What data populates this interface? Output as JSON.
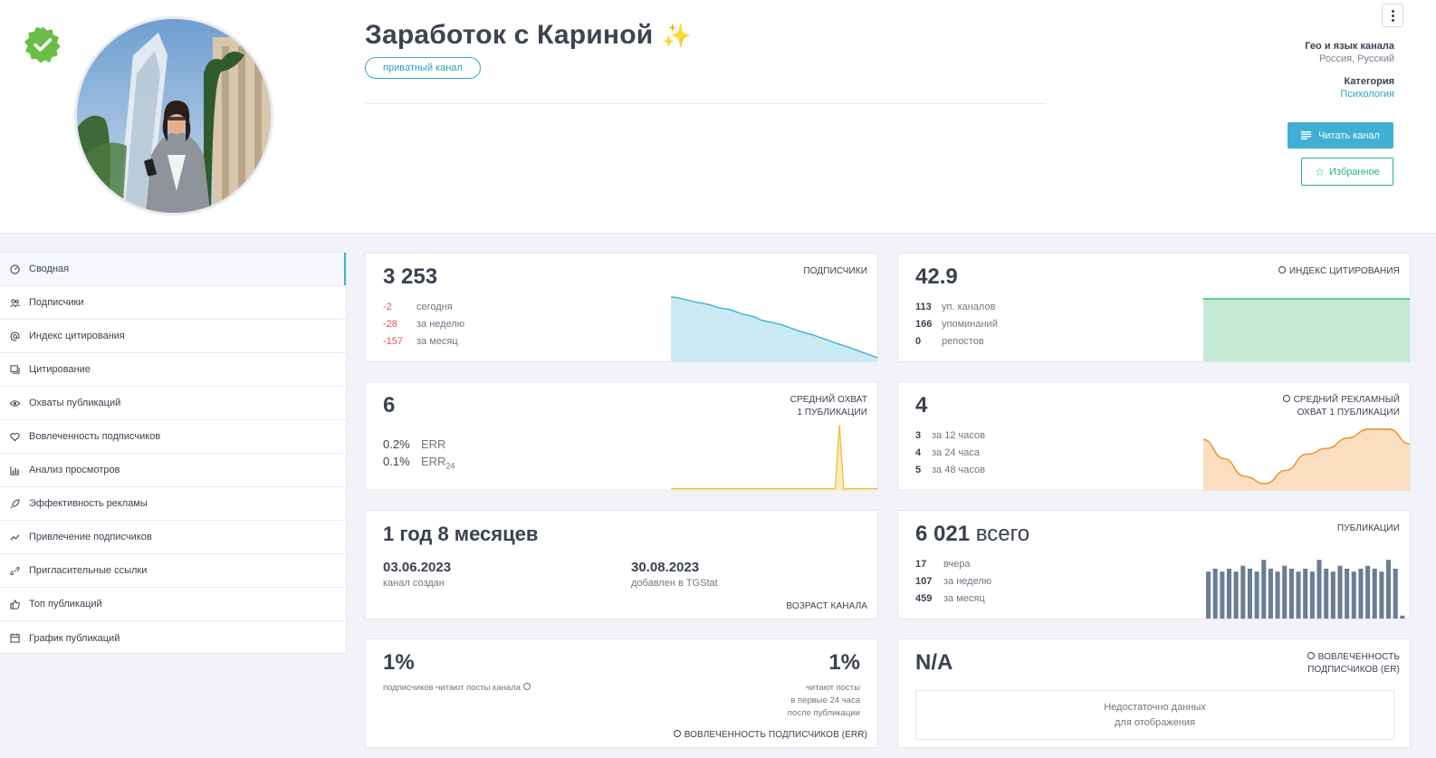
{
  "header": {
    "title": "Заработок с Кариной",
    "title_emoji": "✨",
    "badge": "приватный канал",
    "geo_label": "Гео и язык канала",
    "geo_value": "Россия, Русский",
    "category_label": "Категория",
    "category_value": "Психология",
    "read_button": "Читать канал",
    "favorite_button": "Избранное"
  },
  "sidebar": {
    "items": [
      {
        "label": "Сводная",
        "icon": "dashboard-icon"
      },
      {
        "label": "Подписчики",
        "icon": "users-icon"
      },
      {
        "label": "Индекс цитирования",
        "icon": "at-icon"
      },
      {
        "label": "Цитирование",
        "icon": "quote-icon"
      },
      {
        "label": "Охваты публикаций",
        "icon": "eye-icon"
      },
      {
        "label": "Вовлеченность подписчиков",
        "icon": "heart-icon"
      },
      {
        "label": "Анализ просмотров",
        "icon": "bar-chart-icon"
      },
      {
        "label": "Эффективность рекламы",
        "icon": "rocket-icon"
      },
      {
        "label": "Привлечение подписчиков",
        "icon": "trend-icon"
      },
      {
        "label": "Пригласительные ссылки",
        "icon": "link-icon"
      },
      {
        "label": "Топ публикаций",
        "icon": "thumbs-up-icon"
      },
      {
        "label": "График публикаций",
        "icon": "calendar-icon"
      }
    ]
  },
  "subscribers": {
    "value": "3 253",
    "caption": "ПОДПИСЧИКИ",
    "rows": [
      {
        "n": "-2",
        "t": "сегодня"
      },
      {
        "n": "-28",
        "t": "за неделю"
      },
      {
        "n": "-157",
        "t": "за месяц"
      }
    ],
    "color": "#3fb0d4"
  },
  "citation": {
    "value": "42.9",
    "caption": "ИНДЕКС ЦИТИРОВАНИЯ",
    "rows": [
      {
        "n": "113",
        "t": "уп. каналов"
      },
      {
        "n": "166",
        "t": "упоминаний"
      },
      {
        "n": "0",
        "t": "репостов"
      }
    ],
    "color": "#2eb563"
  },
  "reach": {
    "value": "6",
    "caption1": "СРЕДНИЙ ОХВАТ",
    "caption2": "1 ПУБЛИКАЦИИ",
    "err_value": "0.2%",
    "err_label": "ERR",
    "err24_value": "0.1%",
    "err24_label": "ERR",
    "err24_sub": "24",
    "color": "#f0c02e"
  },
  "ad_reach": {
    "value": "4",
    "caption1": "СРЕДНИЙ РЕКЛАМНЫЙ",
    "caption2": "ОХВАТ 1 ПУБЛИКАЦИИ",
    "rows": [
      {
        "n": "3",
        "t": "за 12 часов"
      },
      {
        "n": "4",
        "t": "за 24 часа"
      },
      {
        "n": "5",
        "t": "за 48 часов"
      }
    ],
    "color": "#f28a1c"
  },
  "age": {
    "value": "1 год 8 месяцев",
    "created_date": "03.06.2023",
    "created_label": "канал создан",
    "added_date": "30.08.2023",
    "added_label": "добавлен в TGStat",
    "caption": "ВОЗРАСТ КАНАЛА"
  },
  "posts": {
    "value": "6 021",
    "value_suffix": "всего",
    "caption": "ПУБЛИКАЦИИ",
    "rows": [
      {
        "n": "17",
        "t": "вчера"
      },
      {
        "n": "107",
        "t": "за неделю"
      },
      {
        "n": "459",
        "t": "за месяц"
      }
    ],
    "color": "#6b7d93"
  },
  "err": {
    "value_left": "1%",
    "label_left": "подписчиков читают посты канала",
    "value_right": "1%",
    "label_right_1": "читают посты",
    "label_right_2": "в первые 24 часа",
    "label_right_3": "после публикации",
    "caption": "ВОВЛЕЧЕННОСТЬ ПОДПИСЧИКОВ (ERR)"
  },
  "er": {
    "value": "N/A",
    "caption1": "ВОВЛЕЧЕННОСТЬ",
    "caption2": "ПОДПИСЧИКОВ (ER)",
    "empty_1": "Недостаточно данных",
    "empty_2": "для отображения"
  },
  "chart_data": [
    {
      "type": "area",
      "series": [
        {
          "values": [
            3410,
            3408,
            3404,
            3400,
            3396,
            3393,
            3390,
            3384,
            3380,
            3378,
            3372,
            3366,
            3362,
            3358,
            3350,
            3346,
            3343,
            3339,
            3333,
            3327,
            3321,
            3316,
            3312,
            3306,
            3300,
            3294,
            3288,
            3283,
            3277,
            3271,
            3265,
            3259,
            3253
          ]
        }
      ]
    },
    {
      "type": "area",
      "series": [
        {
          "values": [
            42.9,
            42.9,
            42.9,
            42.9,
            42.9,
            42.9,
            42.9,
            42.9,
            42.9,
            42.9
          ]
        }
      ]
    },
    {
      "type": "area",
      "series": [
        {
          "values": [
            0,
            0,
            0,
            0,
            0,
            0,
            0,
            0,
            0,
            0,
            0,
            0,
            0,
            0,
            0,
            0,
            0,
            0,
            0,
            0,
            0,
            0,
            0,
            0,
            0,
            0,
            0,
            0,
            0,
            0,
            0,
            0,
            0,
            0,
            0,
            0,
            0,
            0,
            0,
            0,
            6,
            0,
            0,
            0,
            0,
            0,
            0,
            0,
            0,
            0
          ]
        }
      ]
    },
    {
      "type": "area",
      "series": [
        {
          "values": [
            3.3,
            2.0,
            0.8,
            0.3,
            1.2,
            2.3,
            2.7,
            3.4,
            4.0,
            4.0,
            3.0
          ]
        }
      ]
    },
    {
      "type": "bar",
      "series": [
        {
          "values": [
            16,
            17,
            16,
            17,
            16,
            18,
            17,
            16,
            20,
            17,
            16,
            18,
            17,
            16,
            17,
            16,
            20,
            17,
            16,
            18,
            17,
            16,
            17,
            18,
            17,
            16,
            20,
            17,
            1
          ]
        }
      ]
    }
  ]
}
